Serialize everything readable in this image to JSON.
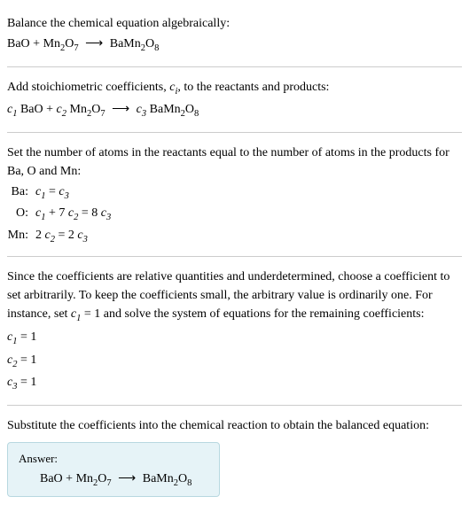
{
  "intro": {
    "instruction": "Balance the chemical equation algebraically:",
    "reactant1": "BaO",
    "plus": "+",
    "reactant2_base": "Mn",
    "reactant2_sub1": "2",
    "reactant2_mid": "O",
    "reactant2_sub2": "7",
    "arrow": "⟶",
    "product_base": "BaMn",
    "product_sub1": "2",
    "product_mid": "O",
    "product_sub2": "8"
  },
  "coeffs": {
    "instruction_pre": "Add stoichiometric coefficients, ",
    "ci": "c",
    "ci_sub": "i",
    "instruction_post": ", to the reactants and products:",
    "c1": "c",
    "c1_sub": "1",
    "r1": " BaO",
    "plus": "+",
    "c2": "c",
    "c2_sub": "2",
    "r2_a": " Mn",
    "r2_s1": "2",
    "r2_b": "O",
    "r2_s2": "7",
    "arrow": "⟶",
    "c3": "c",
    "c3_sub": "3",
    "p_a": " BaMn",
    "p_s1": "2",
    "p_b": "O",
    "p_s2": "8"
  },
  "atoms": {
    "instruction": "Set the number of atoms in the reactants equal to the number of atoms in the products for Ba, O and Mn:",
    "rows": [
      {
        "label": "Ba:",
        "lhs_c": "c",
        "lhs_s": "1",
        "eq": " = ",
        "rhs_c": "c",
        "rhs_s": "3",
        "pre": "",
        "mid": "",
        "mid_c": "",
        "mid_s": "",
        "rpre": ""
      },
      {
        "label": "O:",
        "lhs_c": "c",
        "lhs_s": "1",
        "eq": " = 8 ",
        "rhs_c": "c",
        "rhs_s": "3",
        "pre": "",
        "mid": " + 7 ",
        "mid_c": "c",
        "mid_s": "2",
        "rpre": ""
      },
      {
        "label": "Mn:",
        "lhs_c": "c",
        "lhs_s": "2",
        "eq": " = 2 ",
        "rhs_c": "c",
        "rhs_s": "3",
        "pre": "2 ",
        "mid": "",
        "mid_c": "",
        "mid_s": "",
        "rpre": ""
      }
    ]
  },
  "solve": {
    "instruction_pre": "Since the coefficients are relative quantities and underdetermined, choose a coefficient to set arbitrarily. To keep the coefficients small, the arbitrary value is ordinarily one. For instance, set ",
    "set_c": "c",
    "set_s": "1",
    "instruction_post": " = 1 and solve the system of equations for the remaining coefficients:",
    "results": [
      {
        "c": "c",
        "s": "1",
        "val": " = 1"
      },
      {
        "c": "c",
        "s": "2",
        "val": " = 1"
      },
      {
        "c": "c",
        "s": "3",
        "val": " = 1"
      }
    ]
  },
  "final": {
    "instruction": "Substitute the coefficients into the chemical reaction to obtain the balanced equation:",
    "answer_label": "Answer:",
    "r1": "BaO",
    "plus": "+",
    "r2_a": "Mn",
    "r2_s1": "2",
    "r2_b": "O",
    "r2_s2": "7",
    "arrow": "⟶",
    "p_a": "BaMn",
    "p_s1": "2",
    "p_b": "O",
    "p_s2": "8"
  }
}
